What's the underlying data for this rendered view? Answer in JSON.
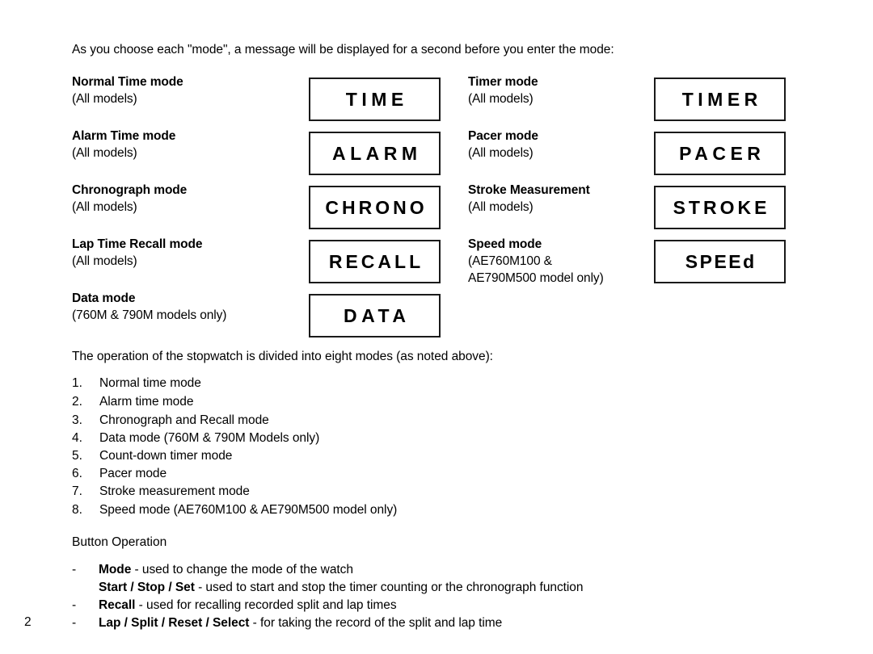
{
  "document": {
    "page_number": "2",
    "intro": "As you choose each \"mode\", a message will be displayed for a second before you enter the mode:",
    "operation_intro": "The operation of the stopwatch is divided into eight modes (as noted above):"
  },
  "modes": {
    "left": [
      {
        "name": "Normal Time mode",
        "models": "(All models)",
        "display": "TIME",
        "spacing": "normal"
      },
      {
        "name": "Alarm Time mode",
        "models": "(All models)",
        "display": "ALARM",
        "spacing": "normal"
      },
      {
        "name": "Chronograph mode",
        "models": "(All models)",
        "display": "CHRONO",
        "spacing": "tight"
      },
      {
        "name": "Lap Time Recall mode",
        "models": "(All models)",
        "display": "RECALL",
        "spacing": "tight"
      },
      {
        "name": "Data mode",
        "models": "(760M & 790M models only)",
        "display": "DATA",
        "spacing": "normal"
      }
    ],
    "right": [
      {
        "name": "Timer mode",
        "models": "(All models)",
        "display": "TIMER",
        "spacing": "normal"
      },
      {
        "name": "Pacer mode",
        "models": "(All models)",
        "display": "PACER",
        "spacing": "normal"
      },
      {
        "name": "Stroke Measurement",
        "models": "(All models)",
        "display": "STROKE",
        "spacing": "tight"
      },
      {
        "name": "Speed mode",
        "models": "(AE760M100 &",
        "models2": "AE790M500 model only)",
        "display": "SPEEd",
        "spacing": "tighter"
      }
    ]
  },
  "mode_list": [
    {
      "num": "1.",
      "text": "Normal time mode"
    },
    {
      "num": "2.",
      "text": "Alarm time mode"
    },
    {
      "num": "3.",
      "text": "Chronograph and Recall mode"
    },
    {
      "num": "4.",
      "text": "Data mode (760M & 790M Models only)"
    },
    {
      "num": "5.",
      "text": "Count-down timer mode"
    },
    {
      "num": "6.",
      "text": "Pacer mode"
    },
    {
      "num": "7.",
      "text": "Stroke measurement mode"
    },
    {
      "num": "8.",
      "text": "Speed mode (AE760M100 & AE790M500 model only)"
    }
  ],
  "button_operation": {
    "heading": "Button Operation",
    "items": [
      {
        "dash": "-",
        "key": "Mode",
        "desc": " - used to change the mode of the watch"
      },
      {
        "dash": "-",
        "key": "Start / Stop / Set",
        "desc": " - used to start and stop the timer counting or the chronograph function"
      },
      {
        "dash": "-",
        "key": "Recall",
        "desc": " - used for recalling recorded split and lap times"
      },
      {
        "dash": "-",
        "key": "Lap / Split / Reset / Select",
        "desc": " - for taking the record of the split and lap time"
      }
    ]
  }
}
